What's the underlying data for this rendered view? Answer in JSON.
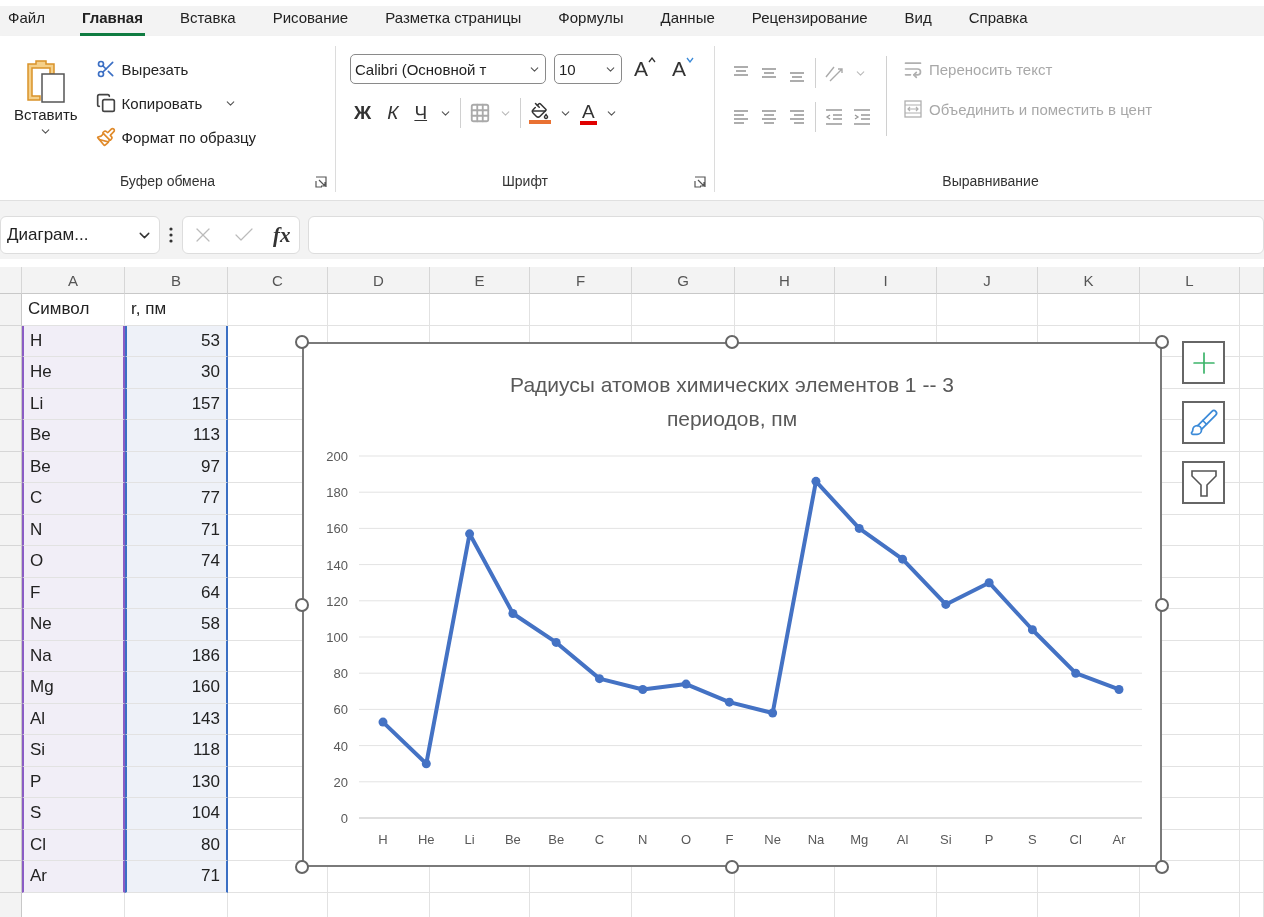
{
  "ribbon_tabs": [
    {
      "label": "Файл",
      "selected": false
    },
    {
      "label": "Главная",
      "selected": true
    },
    {
      "label": "Вставка",
      "selected": false
    },
    {
      "label": "Рисование",
      "selected": false
    },
    {
      "label": "Разметка страницы",
      "selected": false
    },
    {
      "label": "Формулы",
      "selected": false
    },
    {
      "label": "Данные",
      "selected": false
    },
    {
      "label": "Рецензирование",
      "selected": false
    },
    {
      "label": "Вид",
      "selected": false
    },
    {
      "label": "Справка",
      "selected": false
    }
  ],
  "clipboard": {
    "paste": "Вставить",
    "cut": "Вырезать",
    "copy": "Копировать",
    "format_painter": "Формат по образцу",
    "label": "Буфер обмена"
  },
  "font": {
    "name": "Calibri (Основной т",
    "size": "10",
    "grow": "A",
    "shrink": "A",
    "bold": "Ж",
    "italic": "К",
    "underline": "Ч",
    "font_color": "A",
    "label": "Шрифт"
  },
  "alignment": {
    "wrap_text": {
      "label": "Переносить текст",
      "disabled": true
    },
    "merge": {
      "label": "Объединить и поместить в цент",
      "disabled": true
    },
    "label": "Выравнивание"
  },
  "formula_bar": {
    "name_box": "Диаграм...",
    "function_label": "fx"
  },
  "sheet": {
    "columns": [
      "A",
      "B",
      "C",
      "D",
      "E",
      "F",
      "G",
      "H",
      "I",
      "J",
      "K",
      "L"
    ],
    "rows": [
      {
        "cells": [
          "Символ",
          "r, пм"
        ],
        "highlighted": false
      },
      {
        "cells": [
          "H",
          "53"
        ],
        "highlighted": true
      },
      {
        "cells": [
          "He",
          "30"
        ],
        "highlighted": true
      },
      {
        "cells": [
          "Li",
          "157"
        ],
        "highlighted": true
      },
      {
        "cells": [
          "Be",
          "113"
        ],
        "highlighted": true
      },
      {
        "cells": [
          "Be",
          "97"
        ],
        "highlighted": true
      },
      {
        "cells": [
          "C",
          "77"
        ],
        "highlighted": true
      },
      {
        "cells": [
          "N",
          "71"
        ],
        "highlighted": true
      },
      {
        "cells": [
          "O",
          "74"
        ],
        "highlighted": true
      },
      {
        "cells": [
          "F",
          "64"
        ],
        "highlighted": true
      },
      {
        "cells": [
          "Ne",
          "58"
        ],
        "highlighted": true
      },
      {
        "cells": [
          "Na",
          "186"
        ],
        "highlighted": true
      },
      {
        "cells": [
          "Mg",
          "160"
        ],
        "highlighted": true
      },
      {
        "cells": [
          "Al",
          "143"
        ],
        "highlighted": true
      },
      {
        "cells": [
          "Si",
          "118"
        ],
        "highlighted": true
      },
      {
        "cells": [
          "P",
          "130"
        ],
        "highlighted": true
      },
      {
        "cells": [
          "S",
          "104"
        ],
        "highlighted": true
      },
      {
        "cells": [
          "Cl",
          "80"
        ],
        "highlighted": true
      },
      {
        "cells": [
          "Ar",
          "71"
        ],
        "highlighted": true
      }
    ]
  },
  "chart": {
    "chart_data": {
      "type": "line",
      "title": "Радиусы атомов химических элементов 1 -- 3 периодов, пм",
      "categories": [
        "H",
        "He",
        "Li",
        "Be",
        "Be",
        "C",
        "N",
        "O",
        "F",
        "Ne",
        "Na",
        "Mg",
        "Al",
        "Si",
        "P",
        "S",
        "Cl",
        "Ar"
      ],
      "series": [
        {
          "color": "#4472c4",
          "marker": "circle",
          "values": [
            53,
            30,
            157,
            113,
            97,
            77,
            71,
            74,
            64,
            58,
            186,
            160,
            143,
            118,
            130,
            104,
            80,
            71
          ]
        }
      ],
      "grid": true,
      "ylim": [
        0,
        200
      ],
      "yticks": [
        0,
        20,
        40,
        60,
        80,
        100,
        120,
        140,
        160,
        180,
        200
      ]
    }
  }
}
